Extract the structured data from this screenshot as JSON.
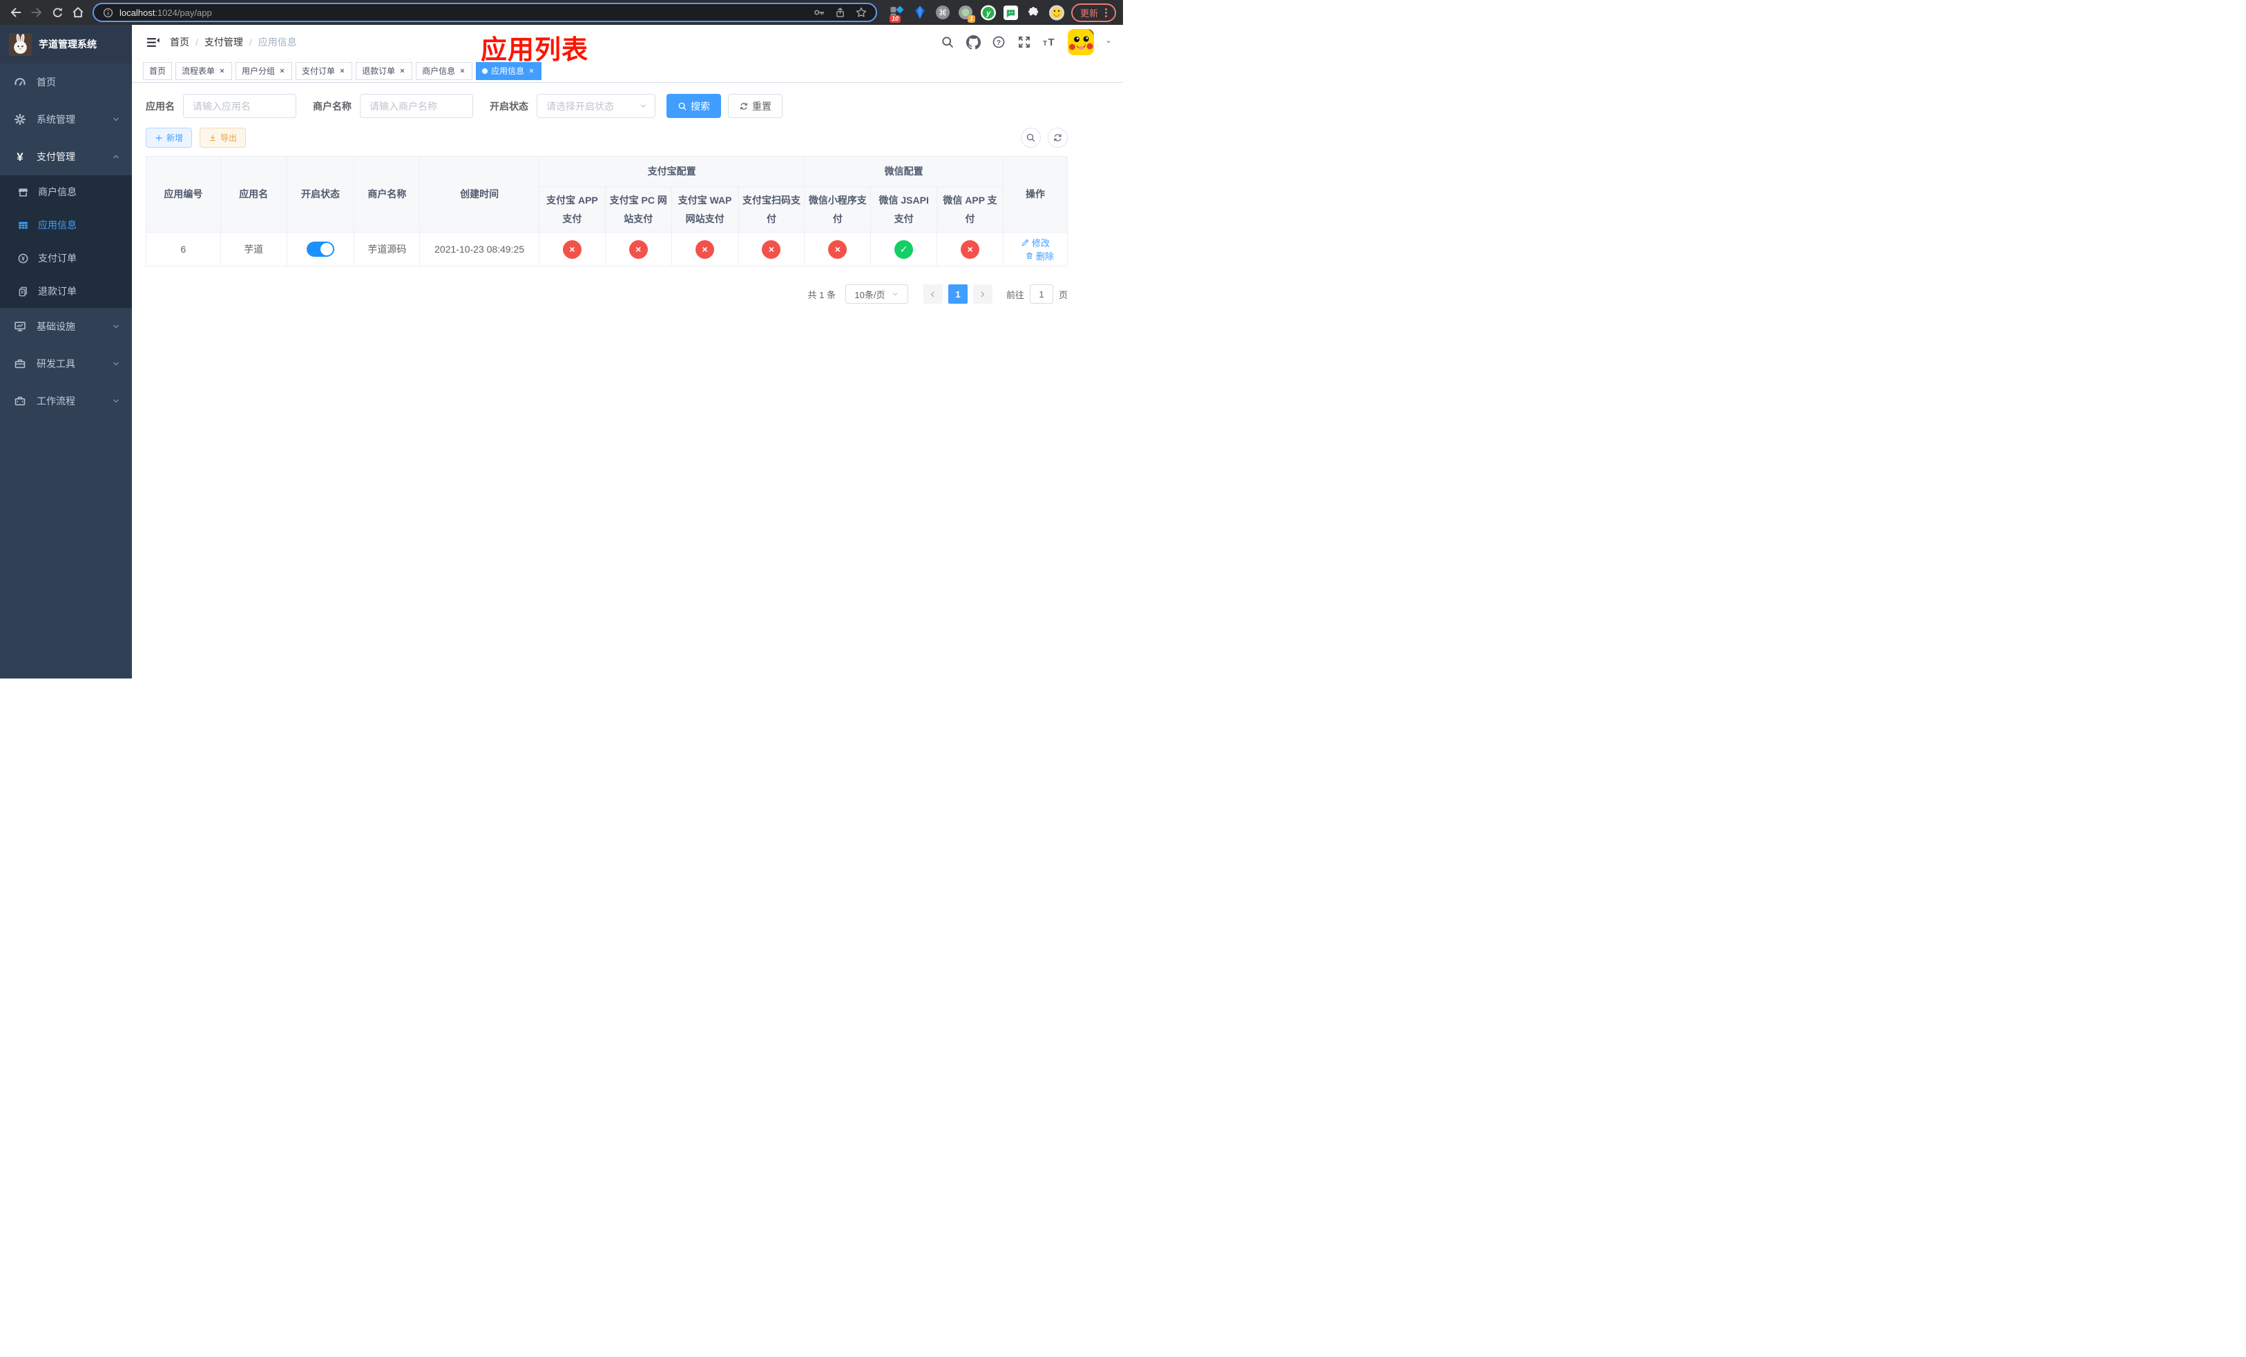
{
  "colors": {
    "primary": "#409eff",
    "success": "#14ce66",
    "danger": "#f3524a",
    "warning": "#e6a23c",
    "annotation_red": "#fe1400",
    "sidebar_bg": "#304156",
    "submenu_bg": "#1f2d3d"
  },
  "browser": {
    "url_host": "localhost",
    "url_path": ":1024/pay/app",
    "update_label": "更新",
    "ext_badge_blocks": "10",
    "ext_badge_circle": "1"
  },
  "sidebar": {
    "title": "芋道管理系统",
    "items": [
      {
        "label": "首页"
      },
      {
        "label": "系统管理"
      },
      {
        "label": "支付管理"
      },
      {
        "label": "基础设施"
      },
      {
        "label": "研发工具"
      },
      {
        "label": "工作流程"
      }
    ],
    "submenu": [
      {
        "label": "商户信息"
      },
      {
        "label": "应用信息"
      },
      {
        "label": "支付订单"
      },
      {
        "label": "退款订单"
      }
    ]
  },
  "navbar": {
    "breadcrumb": [
      "首页",
      "支付管理",
      "应用信息"
    ],
    "annotation": "应用列表"
  },
  "tabs": [
    {
      "label": "首页"
    },
    {
      "label": "流程表单"
    },
    {
      "label": "用户分组"
    },
    {
      "label": "支付订单"
    },
    {
      "label": "退款订单"
    },
    {
      "label": "商户信息"
    },
    {
      "label": "应用信息"
    }
  ],
  "filters": {
    "app_name_label": "应用名",
    "app_name_placeholder": "请输入应用名",
    "merchant_label": "商户名称",
    "merchant_placeholder": "请输入商户名称",
    "status_label": "开启状态",
    "status_placeholder": "请选择开启状态",
    "search_label": "搜索",
    "reset_label": "重置"
  },
  "toolbar": {
    "add_label": "新增",
    "export_label": "导出"
  },
  "table": {
    "group_headers": {
      "alipay": "支付宝配置",
      "wechat": "微信配置"
    },
    "headers": {
      "app_id": "应用编号",
      "app_name": "应用名",
      "status": "开启状态",
      "merchant_name": "商户名称",
      "create_time": "创建时间",
      "alipay_app": "支付宝 APP 支付",
      "alipay_pc": "支付宝 PC 网站支付",
      "alipay_wap": "支付宝 WAP 网站支付",
      "alipay_qr": "支付宝扫码支付",
      "wechat_mini": "微信小程序支付",
      "wechat_jsapi": "微信 JSAPI 支付",
      "wechat_app": "微信 APP 支付",
      "actions": "操作"
    },
    "row": {
      "app_id": "6",
      "app_name": "芋道",
      "switch_on": true,
      "merchant_name": "芋道源码",
      "create_time": "2021-10-23 08:49:25",
      "statuses": [
        "no",
        "no",
        "no",
        "no",
        "no",
        "yes",
        "no"
      ],
      "edit_label": "修改",
      "delete_label": "删除"
    }
  },
  "pagination": {
    "total": "共 1 条",
    "page_size": "10条/页",
    "current_page": "1",
    "goto_label": "前往",
    "goto_value": "1",
    "unit_label": "页"
  }
}
